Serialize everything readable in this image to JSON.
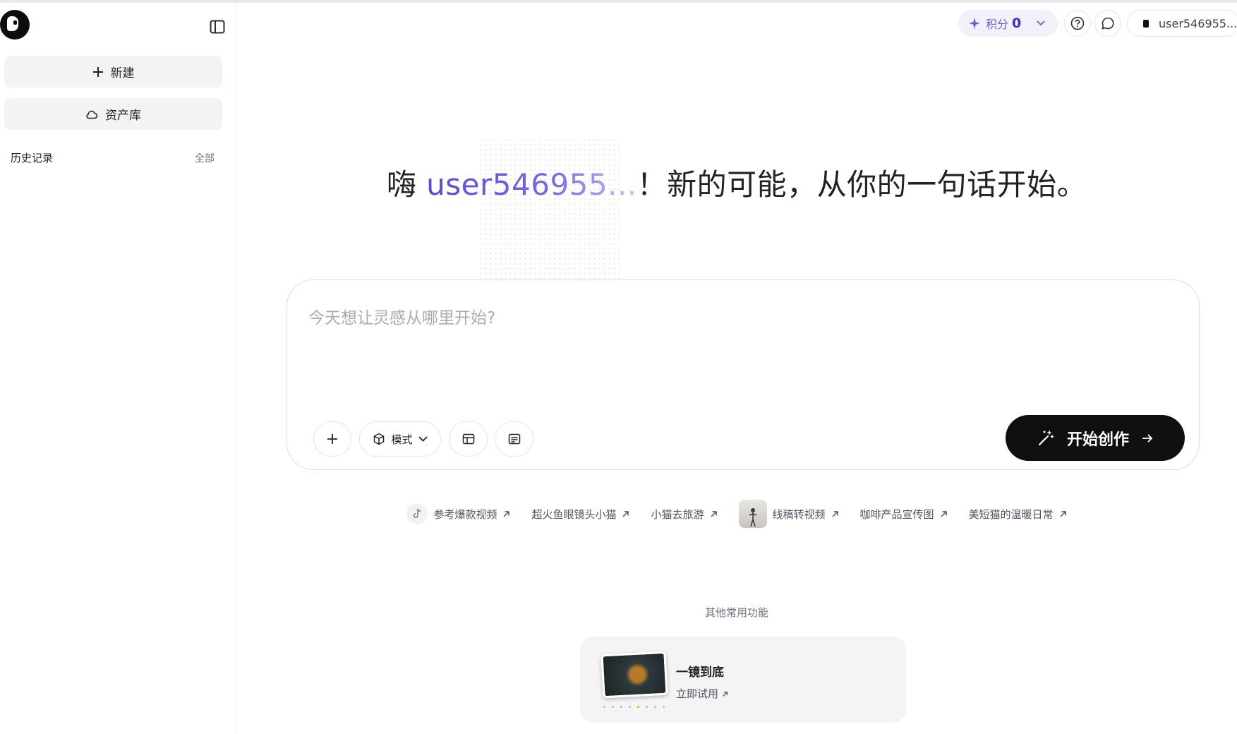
{
  "sidebar": {
    "new_label": "新建",
    "library_label": "资产库",
    "history_label": "历史记录",
    "history_all": "全部"
  },
  "topbar": {
    "points_label": "积分",
    "points_value": "0",
    "username": "user546955..."
  },
  "greeting": {
    "prefix": "嗨 ",
    "username": "user546955...",
    "suffix": "！新的可能，从你的一句话开始。"
  },
  "prompt": {
    "placeholder": "今天想让灵感从哪里开始?",
    "mode_label": "模式",
    "create_label": "开始创作"
  },
  "suggestions": [
    {
      "label": "参考爆款视频"
    },
    {
      "label": "超火鱼眼镜头小猫"
    },
    {
      "label": "小猫去旅游"
    },
    {
      "label": "线稿转视频"
    },
    {
      "label": "咖啡产品宣传图"
    },
    {
      "label": "美短猫的温暖日常"
    }
  ],
  "other": {
    "title": "其他常用功能",
    "feature_title": "一镜到底",
    "feature_action": "立即试用"
  },
  "colors": {
    "accent": "#5b4fd8",
    "button_dark": "#0f0f10"
  }
}
